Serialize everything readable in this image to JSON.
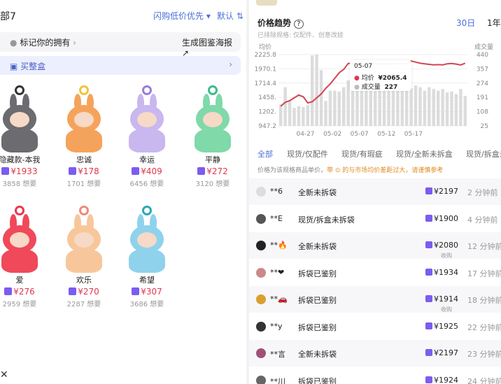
{
  "left": {
    "title": "部7",
    "sort_label": "闪购低价优先",
    "default_label": "默认",
    "mark_row": "标记你的拥有",
    "poster_label": "生成图鉴海报",
    "box_row": "买整盒",
    "items": [
      {
        "name": "隐藏款-本我",
        "price": "¥1933",
        "want": "3858 想要",
        "body": "#6b6b70",
        "ring": "#333"
      },
      {
        "name": "忠诚",
        "price": "¥178",
        "want": "1701 想要",
        "body": "#f5a35c",
        "ring": "#f0c43a"
      },
      {
        "name": "幸运",
        "price": "¥409",
        "want": "6456 想要",
        "body": "#c9b7ef",
        "ring": "#9a7be0"
      },
      {
        "name": "平静",
        "price": "¥272",
        "want": "3120 想要",
        "body": "#7fd9a8",
        "ring": "#3cbb88"
      },
      {
        "name": "爱",
        "price": "¥276",
        "want": "2959 想要",
        "body": "#f0495a",
        "ring": "#e63a4a"
      },
      {
        "name": "欢乐",
        "price": "¥270",
        "want": "2287 想要",
        "body": "#f7c79b",
        "ring": "#f08a7a"
      },
      {
        "name": "希望",
        "price": "¥307",
        "want": "3686 想要",
        "body": "#8fd2ec",
        "ring": "#2aa9b8"
      }
    ]
  },
  "right": {
    "header": "价格趋势",
    "sub": "已排除规格: 仅配件、创意改娃",
    "timeframes": [
      "30日",
      "1年"
    ],
    "y_left_title": "均价",
    "y_right_title": "成交量",
    "tooltip": {
      "date": "05-07",
      "avg_label": "均价",
      "avg_value": "¥2065.4",
      "vol_label": "成交量",
      "vol_value": "227"
    },
    "tabs": [
      "全部",
      "现货/仅配件",
      "现货/有瑕疵",
      "现货/全新未拆盒",
      "现货/拆盒未"
    ],
    "note_a": "价格为该规格商品单价，",
    "note_b": "带 ⊙ 的与市场均价差距过大，请谨慎参考",
    "rows": [
      {
        "user": "**6",
        "cond": "全新未拆袋",
        "price": "¥2197",
        "sub": "",
        "time": "2 分钟前",
        "av": "#ddd"
      },
      {
        "user": "**E",
        "cond": "现货/拆盒未拆袋",
        "price": "¥1900",
        "sub": "",
        "time": "4 分钟前",
        "av": "#555"
      },
      {
        "user": "**🔥",
        "cond": "全新未拆袋",
        "price": "¥2080",
        "sub": "收购",
        "time": "12 分钟前",
        "av": "#222"
      },
      {
        "user": "**❤",
        "cond": "拆袋已鉴别",
        "price": "¥1934",
        "sub": "",
        "time": "17 分钟前",
        "av": "#c88"
      },
      {
        "user": "**🚗",
        "cond": "拆袋已鉴别",
        "price": "¥1914",
        "sub": "收购",
        "time": "18 分钟前",
        "av": "#d9a030"
      },
      {
        "user": "**y",
        "cond": "拆袋已鉴别",
        "price": "¥1925",
        "sub": "",
        "time": "22 分钟前",
        "av": "#333"
      },
      {
        "user": "**言",
        "cond": "全新未拆袋",
        "price": "¥2197",
        "sub": "",
        "time": "23 分钟前",
        "av": "#a05078"
      },
      {
        "user": "**川",
        "cond": "拆袋已鉴别",
        "price": "¥1924",
        "sub": "",
        "time": "24 分钟前",
        "av": "#666"
      }
    ]
  },
  "chart_data": {
    "type": "bar",
    "title": "价格趋势",
    "ylabel_left": "均价",
    "ylabel_right": "成交量",
    "left_ticks": [
      "2225.8",
      "1970.1",
      "1714.4",
      "1458.",
      "1202.",
      "947.2"
    ],
    "right_ticks": [
      "440",
      "357",
      "274",
      "191",
      "108",
      "25"
    ],
    "x_ticks": [
      "04-27",
      "05-02",
      "05-07",
      "05-12",
      "05-17"
    ],
    "ylim_left": [
      947.2,
      2225.8
    ],
    "ylim_right": [
      25,
      440
    ],
    "volume": [
      150,
      250,
      175,
      130,
      140,
      135,
      145,
      435,
      440,
      350,
      170,
      230,
      230,
      225,
      250,
      290,
      295,
      300,
      270,
      270,
      265,
      227,
      240,
      240,
      260,
      250,
      230,
      235,
      240,
      245,
      260,
      250,
      230,
      250,
      240,
      230,
      240,
      220,
      225,
      210,
      240,
      200
    ],
    "avg_price": [
      1300,
      1370,
      1400,
      1450,
      1500,
      1470,
      1360,
      1380,
      1450,
      1520,
      1620,
      1700,
      1800,
      1900,
      1960,
      2065.4,
      2070,
      2065,
      2060,
      2060,
      2070,
      2065.4,
      2062,
      2058,
      2060,
      2060,
      2065,
      2060,
      2065,
      2110,
      2090,
      2070,
      2060,
      2050,
      2040,
      2045,
      2040,
      2060,
      2065,
      2055,
      2040,
      2070
    ]
  }
}
